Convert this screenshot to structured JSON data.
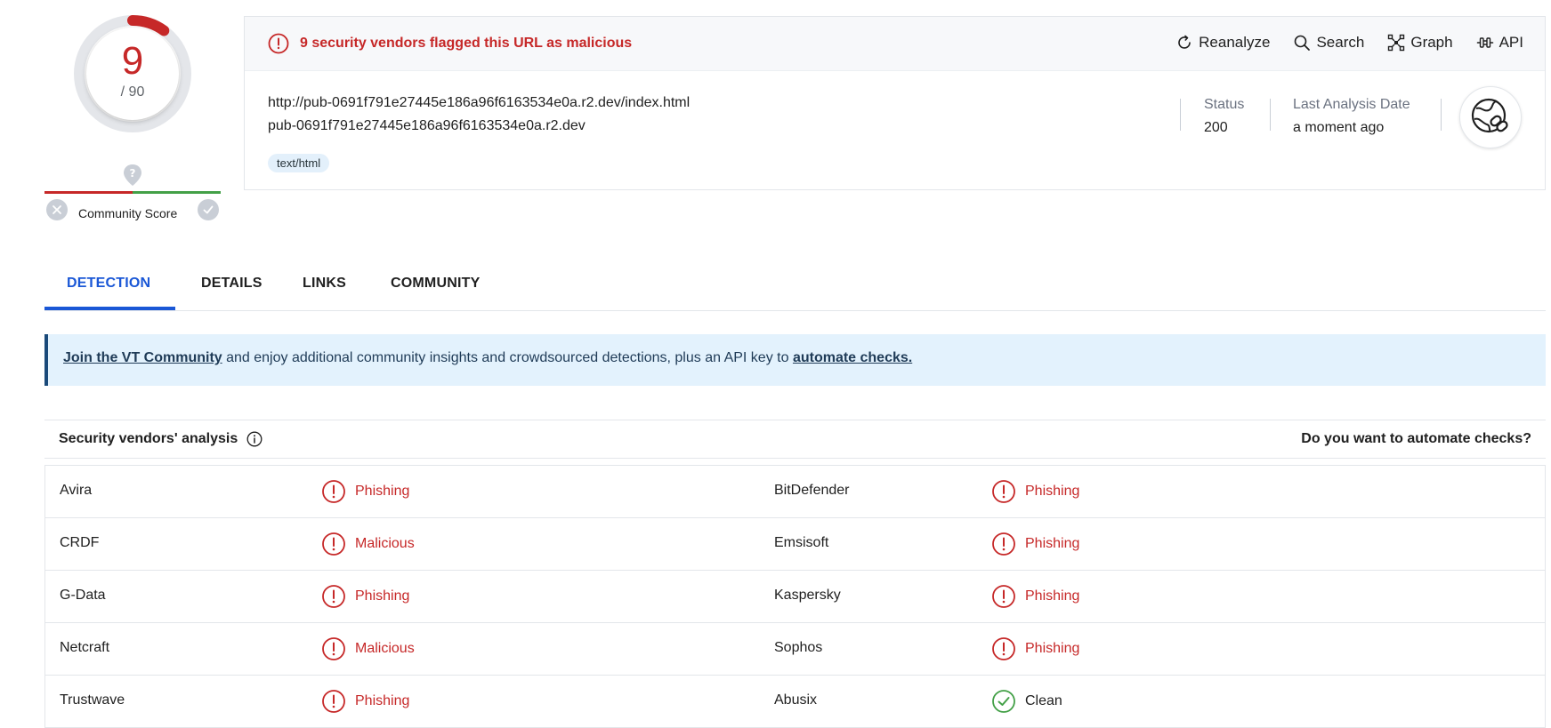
{
  "score": {
    "detected": "9",
    "total": "/ 90",
    "fraction": 0.1
  },
  "community": {
    "label": "Community Score"
  },
  "alert": {
    "text": "9 security vendors flagged this URL as malicious"
  },
  "actions": [
    {
      "label": "Reanalyze",
      "icon": "reanalyze-icon"
    },
    {
      "label": "Search",
      "icon": "search-icon"
    },
    {
      "label": "Graph",
      "icon": "graph-icon"
    },
    {
      "label": "API",
      "icon": "api-icon"
    }
  ],
  "url": {
    "full": "http://pub-0691f791e27445e186a96f6163534e0a.r2.dev/index.html",
    "host": "pub-0691f791e27445e186a96f6163534e0a.r2.dev",
    "tag": "text/html"
  },
  "meta": {
    "status_label": "Status",
    "status_value": "200",
    "date_label": "Last Analysis Date",
    "date_value": "a moment ago"
  },
  "tabs": [
    "DETECTION",
    "DETAILS",
    "LINKS",
    "COMMUNITY"
  ],
  "banner": {
    "link1": "Join the VT Community",
    "middle": " and enjoy additional community insights and crowdsourced detections, plus an API key to ",
    "link2": "automate checks."
  },
  "vendors": {
    "title": "Security vendors' analysis",
    "automate": "Do you want to automate checks?",
    "rows": [
      {
        "left_name": "Avira",
        "left_result": "Phishing",
        "left_status": "bad",
        "right_name": "BitDefender",
        "right_result": "Phishing",
        "right_status": "bad"
      },
      {
        "left_name": "CRDF",
        "left_result": "Malicious",
        "left_status": "bad",
        "right_name": "Emsisoft",
        "right_result": "Phishing",
        "right_status": "bad"
      },
      {
        "left_name": "G-Data",
        "left_result": "Phishing",
        "left_status": "bad",
        "right_name": "Kaspersky",
        "right_result": "Phishing",
        "right_status": "bad"
      },
      {
        "left_name": "Netcraft",
        "left_result": "Malicious",
        "left_status": "bad",
        "right_name": "Sophos",
        "right_result": "Phishing",
        "right_status": "bad"
      },
      {
        "left_name": "Trustwave",
        "left_result": "Phishing",
        "left_status": "bad",
        "right_name": "Abusix",
        "right_result": "Clean",
        "right_status": "good"
      }
    ]
  },
  "colors": {
    "malicious": "#c62828",
    "clean": "#43a047",
    "accent": "#1a57d6"
  }
}
